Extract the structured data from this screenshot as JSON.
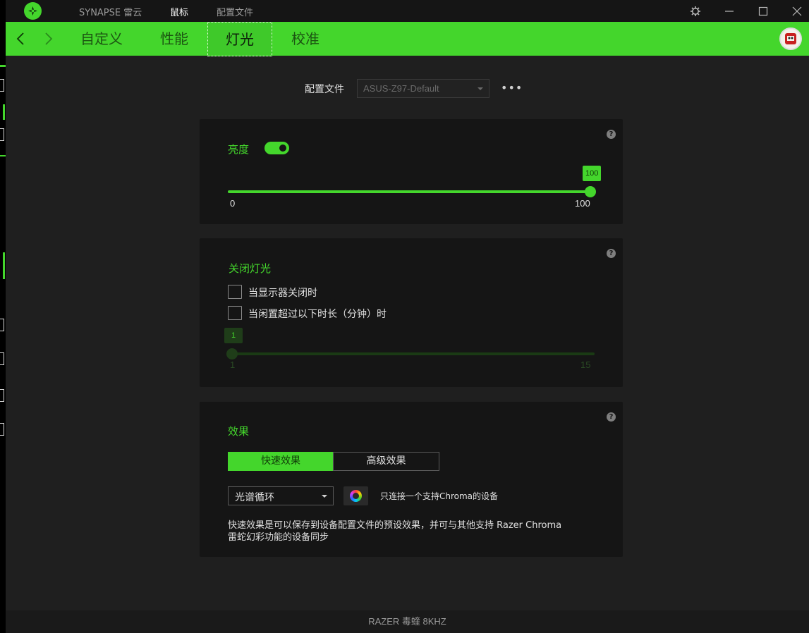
{
  "colors": {
    "accent": "#44d62c",
    "panel": "#151515",
    "background": "#1f1f1f"
  },
  "titlebar": {
    "app_name": "SYNAPSE 雷云",
    "nav": [
      "鼠标",
      "配置文件"
    ],
    "active_nav": "鼠标",
    "icons": [
      "razer-logo-icon",
      "settings-gear-icon",
      "minimize-icon",
      "maximize-icon",
      "close-icon"
    ]
  },
  "tabs": {
    "items": [
      "自定义",
      "性能",
      "灯光",
      "校准"
    ],
    "active": "灯光"
  },
  "profile": {
    "label": "配置文件",
    "value": "ASUS-Z97-Default",
    "more": "•••"
  },
  "brightness": {
    "title": "亮度",
    "enabled": true,
    "value": "100",
    "min": "0",
    "max": "100",
    "fill_fraction": 1.0
  },
  "lighting_off": {
    "title": "关闭灯光",
    "option_display_off": "当显示器关闭时",
    "option_idle": "当闲置超过以下时长（分钟）时",
    "display_off_checked": false,
    "idle_checked": false,
    "idle_value": "1",
    "idle_min": "1",
    "idle_max": "15",
    "fill_fraction": 0.0
  },
  "effects": {
    "title": "效果",
    "seg_quick": "快速效果",
    "seg_advanced": "高级效果",
    "selected_effect": "光谱循环",
    "chroma_note": "只连接一个支持Chroma的设备",
    "description": "快速效果是可以保存到设备配置文件的预设效果，并可与其他支持 Razer Chroma 雷蛇幻彩功能的设备同步"
  },
  "help_symbol": "?",
  "footer": {
    "device": "RAZER 毒蝰 8KHZ"
  }
}
